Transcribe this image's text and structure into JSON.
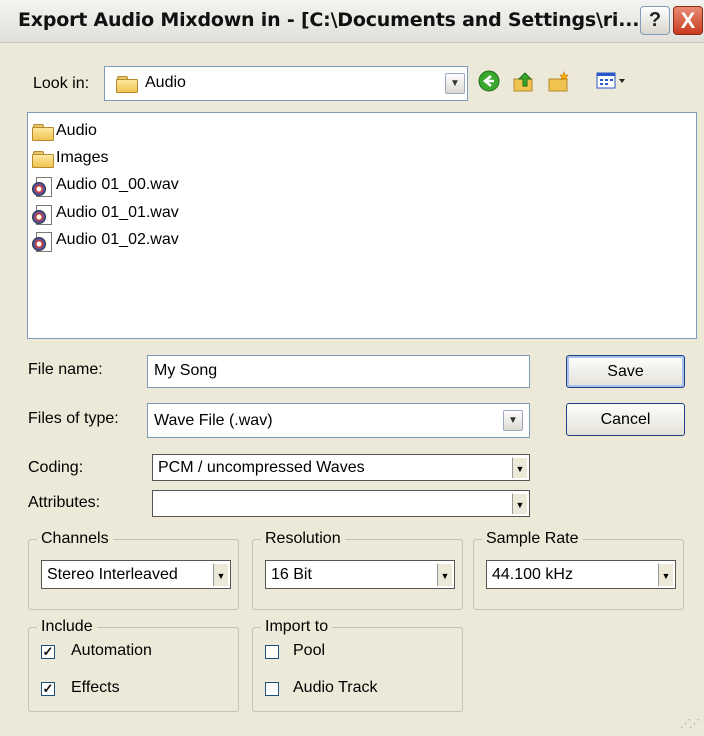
{
  "window": {
    "title": "Export Audio Mixdown in - [C:\\Documents and Settings\\ri...",
    "help_label": "?",
    "close_label": "X"
  },
  "lookin": {
    "label": "Look in:",
    "value": "Audio"
  },
  "files": [
    {
      "name": "Audio",
      "kind": "folder"
    },
    {
      "name": "Images",
      "kind": "folder"
    },
    {
      "name": "Audio 01_00.wav",
      "kind": "wav"
    },
    {
      "name": "Audio 01_01.wav",
      "kind": "wav"
    },
    {
      "name": "Audio 01_02.wav",
      "kind": "wav"
    }
  ],
  "filename": {
    "label": "File name:",
    "value": "My Song"
  },
  "filetype": {
    "label": "Files of type:",
    "value": "Wave File (.wav)"
  },
  "buttons": {
    "save": "Save",
    "cancel": "Cancel"
  },
  "coding": {
    "label": "Coding:",
    "value": "PCM / uncompressed Waves"
  },
  "attributes": {
    "label": "Attributes:",
    "value": ""
  },
  "channels": {
    "legend": "Channels",
    "value": "Stereo Interleaved"
  },
  "resolution": {
    "legend": "Resolution",
    "value": "16 Bit"
  },
  "samplerate": {
    "legend": "Sample Rate",
    "value": "44.100 kHz"
  },
  "include": {
    "legend": "Include",
    "automation": {
      "label": "Automation",
      "checked": true
    },
    "effects": {
      "label": "Effects",
      "checked": true
    }
  },
  "importto": {
    "legend": "Import to",
    "pool": {
      "label": "Pool",
      "checked": false
    },
    "audio_track": {
      "label": "Audio Track",
      "checked": false
    }
  },
  "icons": {
    "back": "back-arrow-icon",
    "up": "up-folder-icon",
    "new_folder": "new-folder-icon",
    "views": "view-menu-icon"
  }
}
